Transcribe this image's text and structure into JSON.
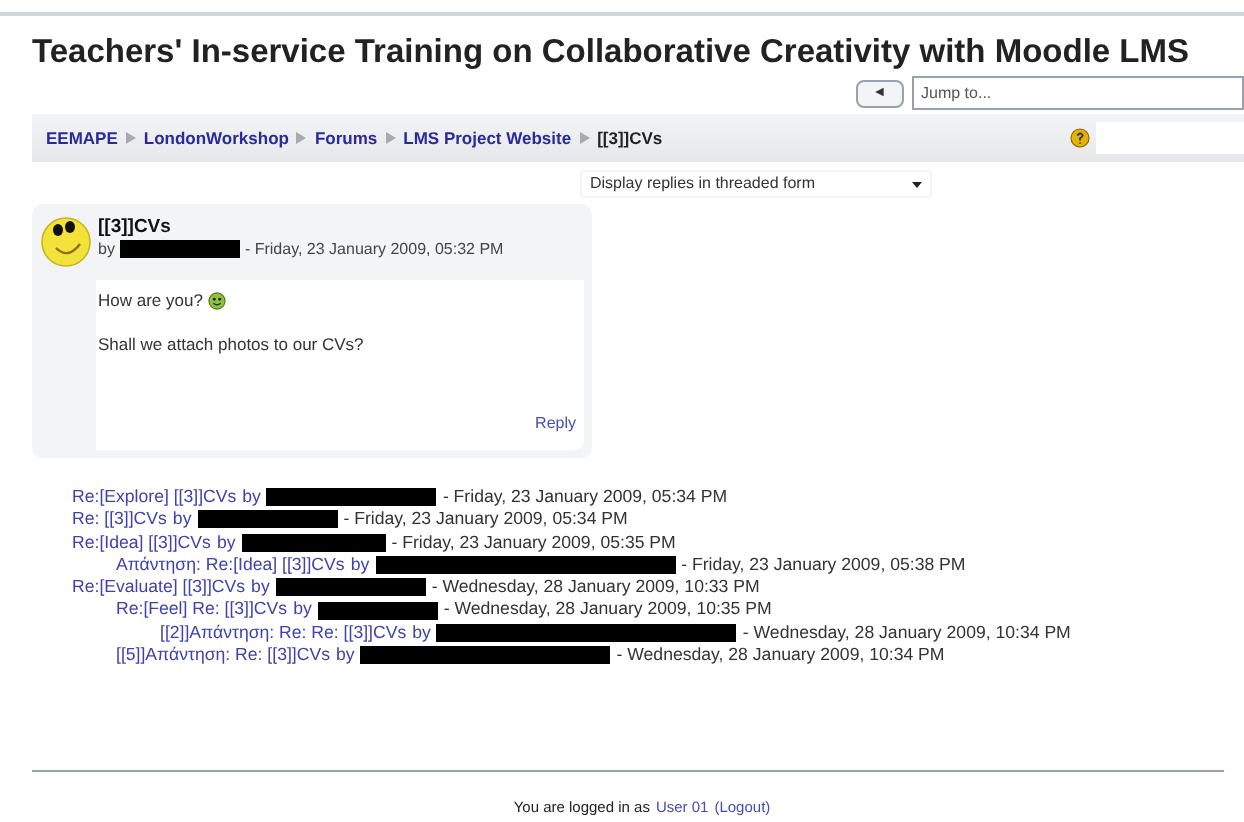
{
  "title": "Teachers' In-service Training on Collaborative Creativity with Moodle LMS",
  "navigation": {
    "back_button": "◄",
    "jump_menu": {
      "value": "Jump to..."
    }
  },
  "breadcrumb": [
    {
      "label": "EEMAPE",
      "link": true
    },
    {
      "label": "LondonWorkshop",
      "link": true
    },
    {
      "label": "Forums",
      "link": true
    },
    {
      "label": "LMS Project Website",
      "link": true
    },
    {
      "label": "[[3]]CVs",
      "link": false
    }
  ],
  "display_mode": {
    "value": "Display replies in threaded form"
  },
  "post": {
    "subject": "[[3]]CVs",
    "by": "by",
    "author_redacted": true,
    "date": "- Friday, 23 January 2009, 05:32 PM",
    "paragraphs": [
      "How are you?",
      "Shall we attach photos to our CVs?"
    ],
    "smiley_after_first": true,
    "reply_link": "Reply"
  },
  "replies": [
    {
      "subject": "Re:[Explore] [[3]]CVs",
      "by": "by",
      "date": "- Friday, 23 January 2009, 05:34 PM"
    },
    {
      "subject": "Re: [[3]]CVs",
      "by": "by",
      "date": "- Friday, 23 January 2009, 05:34 PM"
    },
    {
      "subject": "Re:[Idea] [[3]]CVs",
      "by": "by",
      "date": "- Friday, 23 January 2009, 05:35 PM",
      "children": [
        {
          "subject": "Απάντηση: Re:[Idea] [[3]]CVs",
          "by": "by",
          "date": "- Friday, 23 January 2009, 05:38 PM"
        }
      ]
    },
    {
      "subject": "Re:[Evaluate] [[3]]CVs",
      "by": "by",
      "date": "- Wednesday, 28 January 2009, 10:33 PM",
      "children": [
        {
          "subject": "Re:[Feel] Re: [[3]]CVs",
          "by": "by",
          "date": "- Wednesday, 28 January 2009, 10:35 PM",
          "children": [
            {
              "subject": "[[2]]Απάντηση: Re: Re: [[3]]CVs",
              "by": "by",
              "date": "- Wednesday, 28 January 2009, 10:34 PM"
            }
          ]
        },
        {
          "subject": "[[5]]Απάντηση: Re: [[3]]CVs",
          "by": "by",
          "date": "- Wednesday, 28 January 2009, 10:34 PM"
        }
      ]
    }
  ],
  "footer": {
    "text": "You are logged in as",
    "user_link": "User 01",
    "logout_link": "(Logout)"
  }
}
